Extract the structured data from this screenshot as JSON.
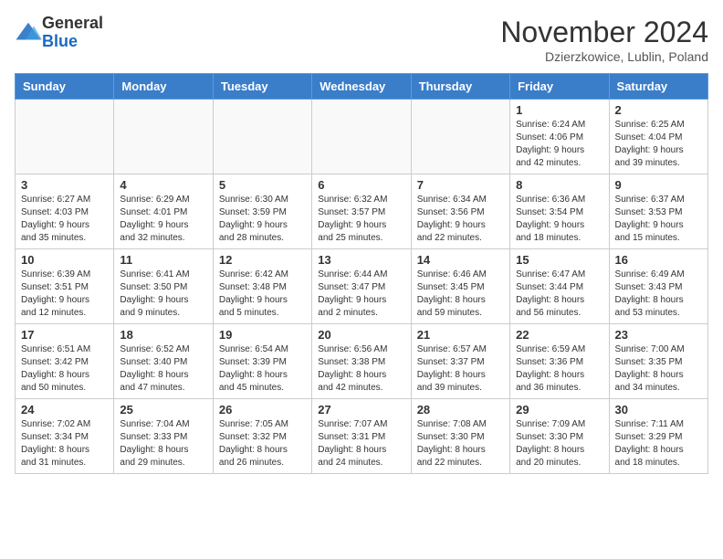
{
  "header": {
    "logo_general": "General",
    "logo_blue": "Blue",
    "month_title": "November 2024",
    "location": "Dzierzkowice, Lublin, Poland"
  },
  "days_of_week": [
    "Sunday",
    "Monday",
    "Tuesday",
    "Wednesday",
    "Thursday",
    "Friday",
    "Saturday"
  ],
  "weeks": [
    [
      {
        "day": "",
        "info": ""
      },
      {
        "day": "",
        "info": ""
      },
      {
        "day": "",
        "info": ""
      },
      {
        "day": "",
        "info": ""
      },
      {
        "day": "",
        "info": ""
      },
      {
        "day": "1",
        "info": "Sunrise: 6:24 AM\nSunset: 4:06 PM\nDaylight: 9 hours\nand 42 minutes."
      },
      {
        "day": "2",
        "info": "Sunrise: 6:25 AM\nSunset: 4:04 PM\nDaylight: 9 hours\nand 39 minutes."
      }
    ],
    [
      {
        "day": "3",
        "info": "Sunrise: 6:27 AM\nSunset: 4:03 PM\nDaylight: 9 hours\nand 35 minutes."
      },
      {
        "day": "4",
        "info": "Sunrise: 6:29 AM\nSunset: 4:01 PM\nDaylight: 9 hours\nand 32 minutes."
      },
      {
        "day": "5",
        "info": "Sunrise: 6:30 AM\nSunset: 3:59 PM\nDaylight: 9 hours\nand 28 minutes."
      },
      {
        "day": "6",
        "info": "Sunrise: 6:32 AM\nSunset: 3:57 PM\nDaylight: 9 hours\nand 25 minutes."
      },
      {
        "day": "7",
        "info": "Sunrise: 6:34 AM\nSunset: 3:56 PM\nDaylight: 9 hours\nand 22 minutes."
      },
      {
        "day": "8",
        "info": "Sunrise: 6:36 AM\nSunset: 3:54 PM\nDaylight: 9 hours\nand 18 minutes."
      },
      {
        "day": "9",
        "info": "Sunrise: 6:37 AM\nSunset: 3:53 PM\nDaylight: 9 hours\nand 15 minutes."
      }
    ],
    [
      {
        "day": "10",
        "info": "Sunrise: 6:39 AM\nSunset: 3:51 PM\nDaylight: 9 hours\nand 12 minutes."
      },
      {
        "day": "11",
        "info": "Sunrise: 6:41 AM\nSunset: 3:50 PM\nDaylight: 9 hours\nand 9 minutes."
      },
      {
        "day": "12",
        "info": "Sunrise: 6:42 AM\nSunset: 3:48 PM\nDaylight: 9 hours\nand 5 minutes."
      },
      {
        "day": "13",
        "info": "Sunrise: 6:44 AM\nSunset: 3:47 PM\nDaylight: 9 hours\nand 2 minutes."
      },
      {
        "day": "14",
        "info": "Sunrise: 6:46 AM\nSunset: 3:45 PM\nDaylight: 8 hours\nand 59 minutes."
      },
      {
        "day": "15",
        "info": "Sunrise: 6:47 AM\nSunset: 3:44 PM\nDaylight: 8 hours\nand 56 minutes."
      },
      {
        "day": "16",
        "info": "Sunrise: 6:49 AM\nSunset: 3:43 PM\nDaylight: 8 hours\nand 53 minutes."
      }
    ],
    [
      {
        "day": "17",
        "info": "Sunrise: 6:51 AM\nSunset: 3:42 PM\nDaylight: 8 hours\nand 50 minutes."
      },
      {
        "day": "18",
        "info": "Sunrise: 6:52 AM\nSunset: 3:40 PM\nDaylight: 8 hours\nand 47 minutes."
      },
      {
        "day": "19",
        "info": "Sunrise: 6:54 AM\nSunset: 3:39 PM\nDaylight: 8 hours\nand 45 minutes."
      },
      {
        "day": "20",
        "info": "Sunrise: 6:56 AM\nSunset: 3:38 PM\nDaylight: 8 hours\nand 42 minutes."
      },
      {
        "day": "21",
        "info": "Sunrise: 6:57 AM\nSunset: 3:37 PM\nDaylight: 8 hours\nand 39 minutes."
      },
      {
        "day": "22",
        "info": "Sunrise: 6:59 AM\nSunset: 3:36 PM\nDaylight: 8 hours\nand 36 minutes."
      },
      {
        "day": "23",
        "info": "Sunrise: 7:00 AM\nSunset: 3:35 PM\nDaylight: 8 hours\nand 34 minutes."
      }
    ],
    [
      {
        "day": "24",
        "info": "Sunrise: 7:02 AM\nSunset: 3:34 PM\nDaylight: 8 hours\nand 31 minutes."
      },
      {
        "day": "25",
        "info": "Sunrise: 7:04 AM\nSunset: 3:33 PM\nDaylight: 8 hours\nand 29 minutes."
      },
      {
        "day": "26",
        "info": "Sunrise: 7:05 AM\nSunset: 3:32 PM\nDaylight: 8 hours\nand 26 minutes."
      },
      {
        "day": "27",
        "info": "Sunrise: 7:07 AM\nSunset: 3:31 PM\nDaylight: 8 hours\nand 24 minutes."
      },
      {
        "day": "28",
        "info": "Sunrise: 7:08 AM\nSunset: 3:30 PM\nDaylight: 8 hours\nand 22 minutes."
      },
      {
        "day": "29",
        "info": "Sunrise: 7:09 AM\nSunset: 3:30 PM\nDaylight: 8 hours\nand 20 minutes."
      },
      {
        "day": "30",
        "info": "Sunrise: 7:11 AM\nSunset: 3:29 PM\nDaylight: 8 hours\nand 18 minutes."
      }
    ]
  ]
}
